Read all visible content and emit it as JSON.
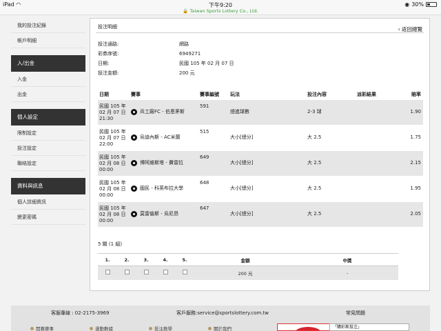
{
  "status_bar": {
    "device": "iPad",
    "time": "下午9:20",
    "url": "Taiwan Sports Lottery Co., Ltd.",
    "battery": "30%",
    "battery_level": 0.3
  },
  "sidebar": {
    "top_links": [
      "我的投注紀錄",
      "帳戶明細"
    ],
    "sections": [
      {
        "title": "入/出金",
        "items": [
          "入金",
          "出金"
        ]
      },
      {
        "title": "個人設定",
        "items": [
          "限制設定",
          "投注設定",
          "聯絡設定"
        ]
      },
      {
        "title": "資料與訊息",
        "items": [
          "個人詳細資訊",
          "變更密碼"
        ]
      }
    ]
  },
  "main": {
    "title": "投注明細",
    "back_label": "返回總覽",
    "info": [
      {
        "label": "投注通路:",
        "value": "網路"
      },
      {
        "label": "彩券序號:",
        "value": "6949271"
      },
      {
        "label": "日期:",
        "value": "民國 105 年 02 月 07 日"
      },
      {
        "label": "投注金額:",
        "value": "200 元"
      }
    ],
    "columns": [
      "日期",
      "賽事",
      "賽事編號",
      "玩法",
      "投注內容",
      "派彩結果",
      "賠率"
    ],
    "bets": [
      {
        "date": [
          "民國 105 年",
          "02 月 07 日",
          "21:30"
        ],
        "match": "兵工廠FC - 伯恩茅斯",
        "id": "591",
        "type": "總進球數",
        "pick": "2-3 球",
        "result": "",
        "odds": "1.90"
      },
      {
        "date": [
          "民國 105 年",
          "02 月 07 日",
          "22:00"
        ],
        "match": "烏迪內斯 - AC米蘭",
        "id": "515",
        "type": "大小[總分]",
        "pick": "大 2.5",
        "result": "",
        "odds": "1.75"
      },
      {
        "date": [
          "民國 105 年",
          "02 月 08 日",
          "00:00"
        ],
        "match": "博阿維斯塔 - 費雷拉",
        "id": "649",
        "type": "大小[總分]",
        "pick": "大 2.5",
        "result": "",
        "odds": "2.15"
      },
      {
        "date": [
          "民國 105 年",
          "02 月 08 日",
          "00:00"
        ],
        "match": "國民 - 科英布拉大學",
        "id": "648",
        "type": "大小[總分]",
        "pick": "大 2.5",
        "result": "",
        "odds": "1.95"
      },
      {
        "date": [
          "民國 105 年",
          "02 月 08 日",
          "00:00"
        ],
        "match": "莫雷倫斯 - 烏尼昂",
        "id": "647",
        "type": "大小[總分]",
        "pick": "大 2.5",
        "result": "",
        "odds": "2.05"
      }
    ],
    "combo_count": "5 關 (1 組)",
    "summary_headers": [
      "1.",
      "2.",
      "3.",
      "4.",
      "5.",
      "金額",
      "中獎"
    ],
    "summary_amount": "200 元",
    "summary_win": "-"
  },
  "footer": {
    "service_hotline": "客服專線 :   02-2175-3969",
    "service_email": "客戶服務:service@sportslottery.com.tw",
    "faq": "常見問題",
    "links": [
      "開賽賽事",
      "運動數據",
      "投注教學",
      "關於我們"
    ],
    "promo_text": "「購彩斯投注」"
  },
  "colors": {
    "sidebar_header_bg": "#333333",
    "row_grey": "#e6e6e6",
    "url_green": "#3a9a3a",
    "footer_dot": "#b69a66",
    "promo_red": "#d9232e"
  }
}
